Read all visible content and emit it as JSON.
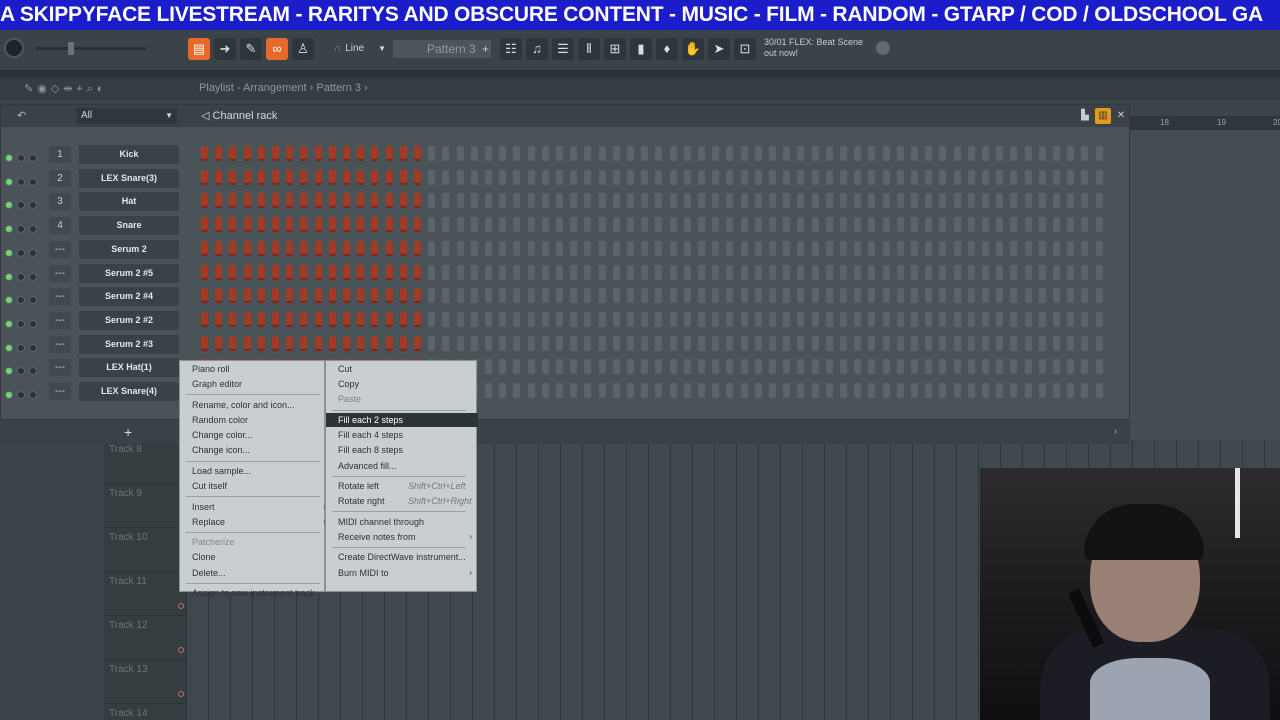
{
  "banner": {
    "text": "A SKIPPYFACE LIVESTREAM  - RARITYS AND OBSCURE CONTENT - MUSIC - FILM - RANDOM - GTARP / COD / OLDSCHOOL GA"
  },
  "toolbar": {
    "snap_label": "Line",
    "pattern_label": "Pattern 3",
    "pattern_plus": "+",
    "news_line1": "30/01 FLEX: Beat Scene",
    "news_line2": "out now!"
  },
  "playlist_bar": {
    "crumb": "Playlist - Arrangement › Pattern 3 ›"
  },
  "channel_rack": {
    "filter": "All",
    "title": "Channel rack",
    "add_label": "+",
    "steps_per_row": 64,
    "steps_on": 16,
    "channels": [
      {
        "num": "1",
        "name": "Kick"
      },
      {
        "num": "2",
        "name": "LEX Snare(3)"
      },
      {
        "num": "3",
        "name": "Hat"
      },
      {
        "num": "4",
        "name": "Snare"
      },
      {
        "num": "---",
        "name": "Serum 2"
      },
      {
        "num": "---",
        "name": "Serum 2 #5"
      },
      {
        "num": "---",
        "name": "Serum 2 #4"
      },
      {
        "num": "---",
        "name": "Serum 2 #2"
      },
      {
        "num": "---",
        "name": "Serum 2 #3"
      },
      {
        "num": "---",
        "name": "LEX Hat(1)"
      },
      {
        "num": "---",
        "name": "LEX Snare(4)"
      }
    ]
  },
  "ruler": {
    "m18": "18",
    "m19": "19",
    "m20": "20"
  },
  "tracks": [
    {
      "label": "Track 8"
    },
    {
      "label": "Track 9"
    },
    {
      "label": "Track 10"
    },
    {
      "label": "Track 11"
    },
    {
      "label": "Track 12"
    },
    {
      "label": "Track 13"
    },
    {
      "label": "Track 14"
    }
  ],
  "context_menu": {
    "left": [
      {
        "label": "Piano roll",
        "disabled": false
      },
      {
        "label": "Graph editor",
        "disabled": false
      },
      {
        "label": "Rename, color and icon...",
        "disabled": false
      },
      {
        "label": "Random color",
        "disabled": false
      },
      {
        "label": "Change color...",
        "disabled": false
      },
      {
        "label": "Change icon...",
        "disabled": false
      },
      {
        "label": "Load sample...",
        "disabled": false
      },
      {
        "label": "Cut itself",
        "disabled": false
      },
      {
        "label": "Insert",
        "disabled": false,
        "submenu": true
      },
      {
        "label": "Replace",
        "disabled": false,
        "submenu": true
      },
      {
        "label": "Patcherize",
        "disabled": true
      },
      {
        "label": "Clone",
        "disabled": false
      },
      {
        "label": "Delete...",
        "disabled": false
      },
      {
        "label": "Assign to new instrument track",
        "disabled": false
      }
    ],
    "right": [
      {
        "label": "Cut",
        "disabled": false
      },
      {
        "label": "Copy",
        "disabled": false
      },
      {
        "label": "Paste",
        "disabled": true
      },
      {
        "label": "Fill each 2 steps",
        "disabled": false,
        "highlight": true
      },
      {
        "label": "Fill each 4 steps",
        "disabled": false
      },
      {
        "label": "Fill each 8 steps",
        "disabled": false
      },
      {
        "label": "Advanced fill...",
        "disabled": false
      },
      {
        "label": "Rotate left",
        "shortcut": "Shift+Ctrl+Left",
        "disabled": false
      },
      {
        "label": "Rotate right",
        "shortcut": "Shift+Ctrl+Right",
        "disabled": false
      },
      {
        "label": "MIDI channel through",
        "disabled": false
      },
      {
        "label": "Receive notes from",
        "disabled": false,
        "submenu": true
      },
      {
        "label": "Create DirectWave instrument...",
        "disabled": false
      },
      {
        "label": "Burn MIDI to",
        "disabled": false,
        "submenu": true
      }
    ]
  },
  "colors": {
    "banner_bg": "#1a1dc9",
    "accent_orange": "#e86a2a",
    "step_on": "#a33a26",
    "step_off": "#5c6468",
    "menu_highlight": "#2d3438"
  }
}
